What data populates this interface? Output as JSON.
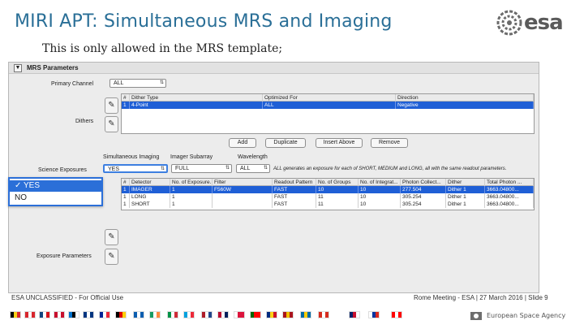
{
  "slide": {
    "title": "MIRI APT: Simultaneous MRS and Imaging",
    "subtitle": "This is only allowed in the MRS template;",
    "logo_text": "esa",
    "logo_icon": "esa-globe-icon"
  },
  "app": {
    "section_header": "MRS Parameters",
    "collapse_glyph": "▼",
    "primary_channel_label": "Primary Channel",
    "primary_channel_value": "ALL",
    "dithers_label": "Dithers",
    "dither_table": {
      "columns": [
        "#",
        "Dither Type",
        "Optimized For",
        "Direction"
      ],
      "rows": [
        {
          "n": "1",
          "type": "4-Point",
          "optimized": "ALL",
          "direction": "Negative",
          "selected": true
        }
      ]
    },
    "buttons": {
      "add": "Add",
      "duplicate": "Duplicate",
      "insert_above": "Insert Above",
      "remove": "Remove"
    },
    "simultaneous_imaging_label": "Simultaneous Imaging",
    "imager_subarray_label": "Imager Subarray",
    "wavelength_label": "Wavelength",
    "science_exposures_label": "Science Exposures",
    "simultaneous_value": "YES",
    "subarray_value": "FULL",
    "wavelength_value": "ALL",
    "wavelength_note": "ALL generates an exposure for each of SHORT, MEDIUM and LONG, all with the same readout parameters.",
    "exposure_table": {
      "columns": [
        "#",
        "Detector",
        "No. of Exposure...",
        "Filter",
        "Readout Pattern",
        "No. of Groups",
        "No. of Integrat...",
        "Photon Collect...",
        "Dither",
        "Total Photon ..."
      ],
      "rows": [
        {
          "cells": [
            "1",
            "IMAGER",
            "1",
            "F560W",
            "FAST",
            "10",
            "10",
            "277.504",
            "Dither 1",
            "3663.04800..."
          ],
          "selected": true
        },
        {
          "cells": [
            "1",
            "LONG",
            "1",
            "",
            "FAST",
            "11",
            "10",
            "305.254",
            "Dither 1",
            "3663.04800..."
          ],
          "selected": false
        },
        {
          "cells": [
            "1",
            "SHORT",
            "1",
            "",
            "FAST",
            "11",
            "10",
            "305.254",
            "Dither 1",
            "3663.04800..."
          ],
          "selected": false
        }
      ]
    },
    "exposure_parameters_label": "Exposure Parameters",
    "popup_options": [
      {
        "label": "✓ YES",
        "active": true
      },
      {
        "label": "NO",
        "active": false
      }
    ]
  },
  "footer": {
    "left_text": "ESA UNCLASSIFIED - For Official Use",
    "right_text": "Rome Meeting - ESA | 27 March 2016 | Slide 9",
    "agency": "European Space Agency",
    "flag_colors": [
      [
        "#000000",
        "#f7d117",
        "#d8262d"
      ],
      [
        "#d8262d",
        "#ffffff",
        "#d8262d"
      ],
      [
        "#11457e",
        "#ffffff",
        "#d7141a"
      ],
      [
        "#c8102e",
        "#ffffff",
        "#c8102e"
      ],
      [
        "#0072ce",
        "#000000",
        "#ffffff"
      ],
      [
        "#003580",
        "#ffffff",
        "#003580"
      ],
      [
        "#002395",
        "#ffffff",
        "#ed2939"
      ],
      [
        "#000000",
        "#dd0000",
        "#ffce00"
      ],
      [
        "#0d5eaf",
        "#ffffff",
        "#0d5eaf"
      ],
      [
        "#169b62",
        "#ffffff",
        "#ff883e"
      ],
      [
        "#009246",
        "#ffffff",
        "#ce2b37"
      ],
      [
        "#00a1de",
        "#ffffff",
        "#ed2939"
      ],
      [
        "#ae1c28",
        "#ffffff",
        "#21468b"
      ],
      [
        "#ba0c2f",
        "#ffffff",
        "#00205b"
      ],
      [
        "#ffffff",
        "#dc143c",
        "#dc143c"
      ],
      [
        "#006600",
        "#ff0000",
        "#ff0000"
      ],
      [
        "#002b7f",
        "#fcd116",
        "#ce1126"
      ],
      [
        "#aa151b",
        "#f1bf00",
        "#aa151b"
      ],
      [
        "#006aa7",
        "#fecc00",
        "#006aa7"
      ],
      [
        "#d52b1e",
        "#ffffff",
        "#d52b1e"
      ],
      [
        "#012169",
        "#c8102e",
        "#ffffff"
      ],
      [
        "#ffffff",
        "#0033a0",
        "#da291c"
      ],
      [
        "#ff0000",
        "#ffffff",
        "#ff0000"
      ]
    ]
  }
}
